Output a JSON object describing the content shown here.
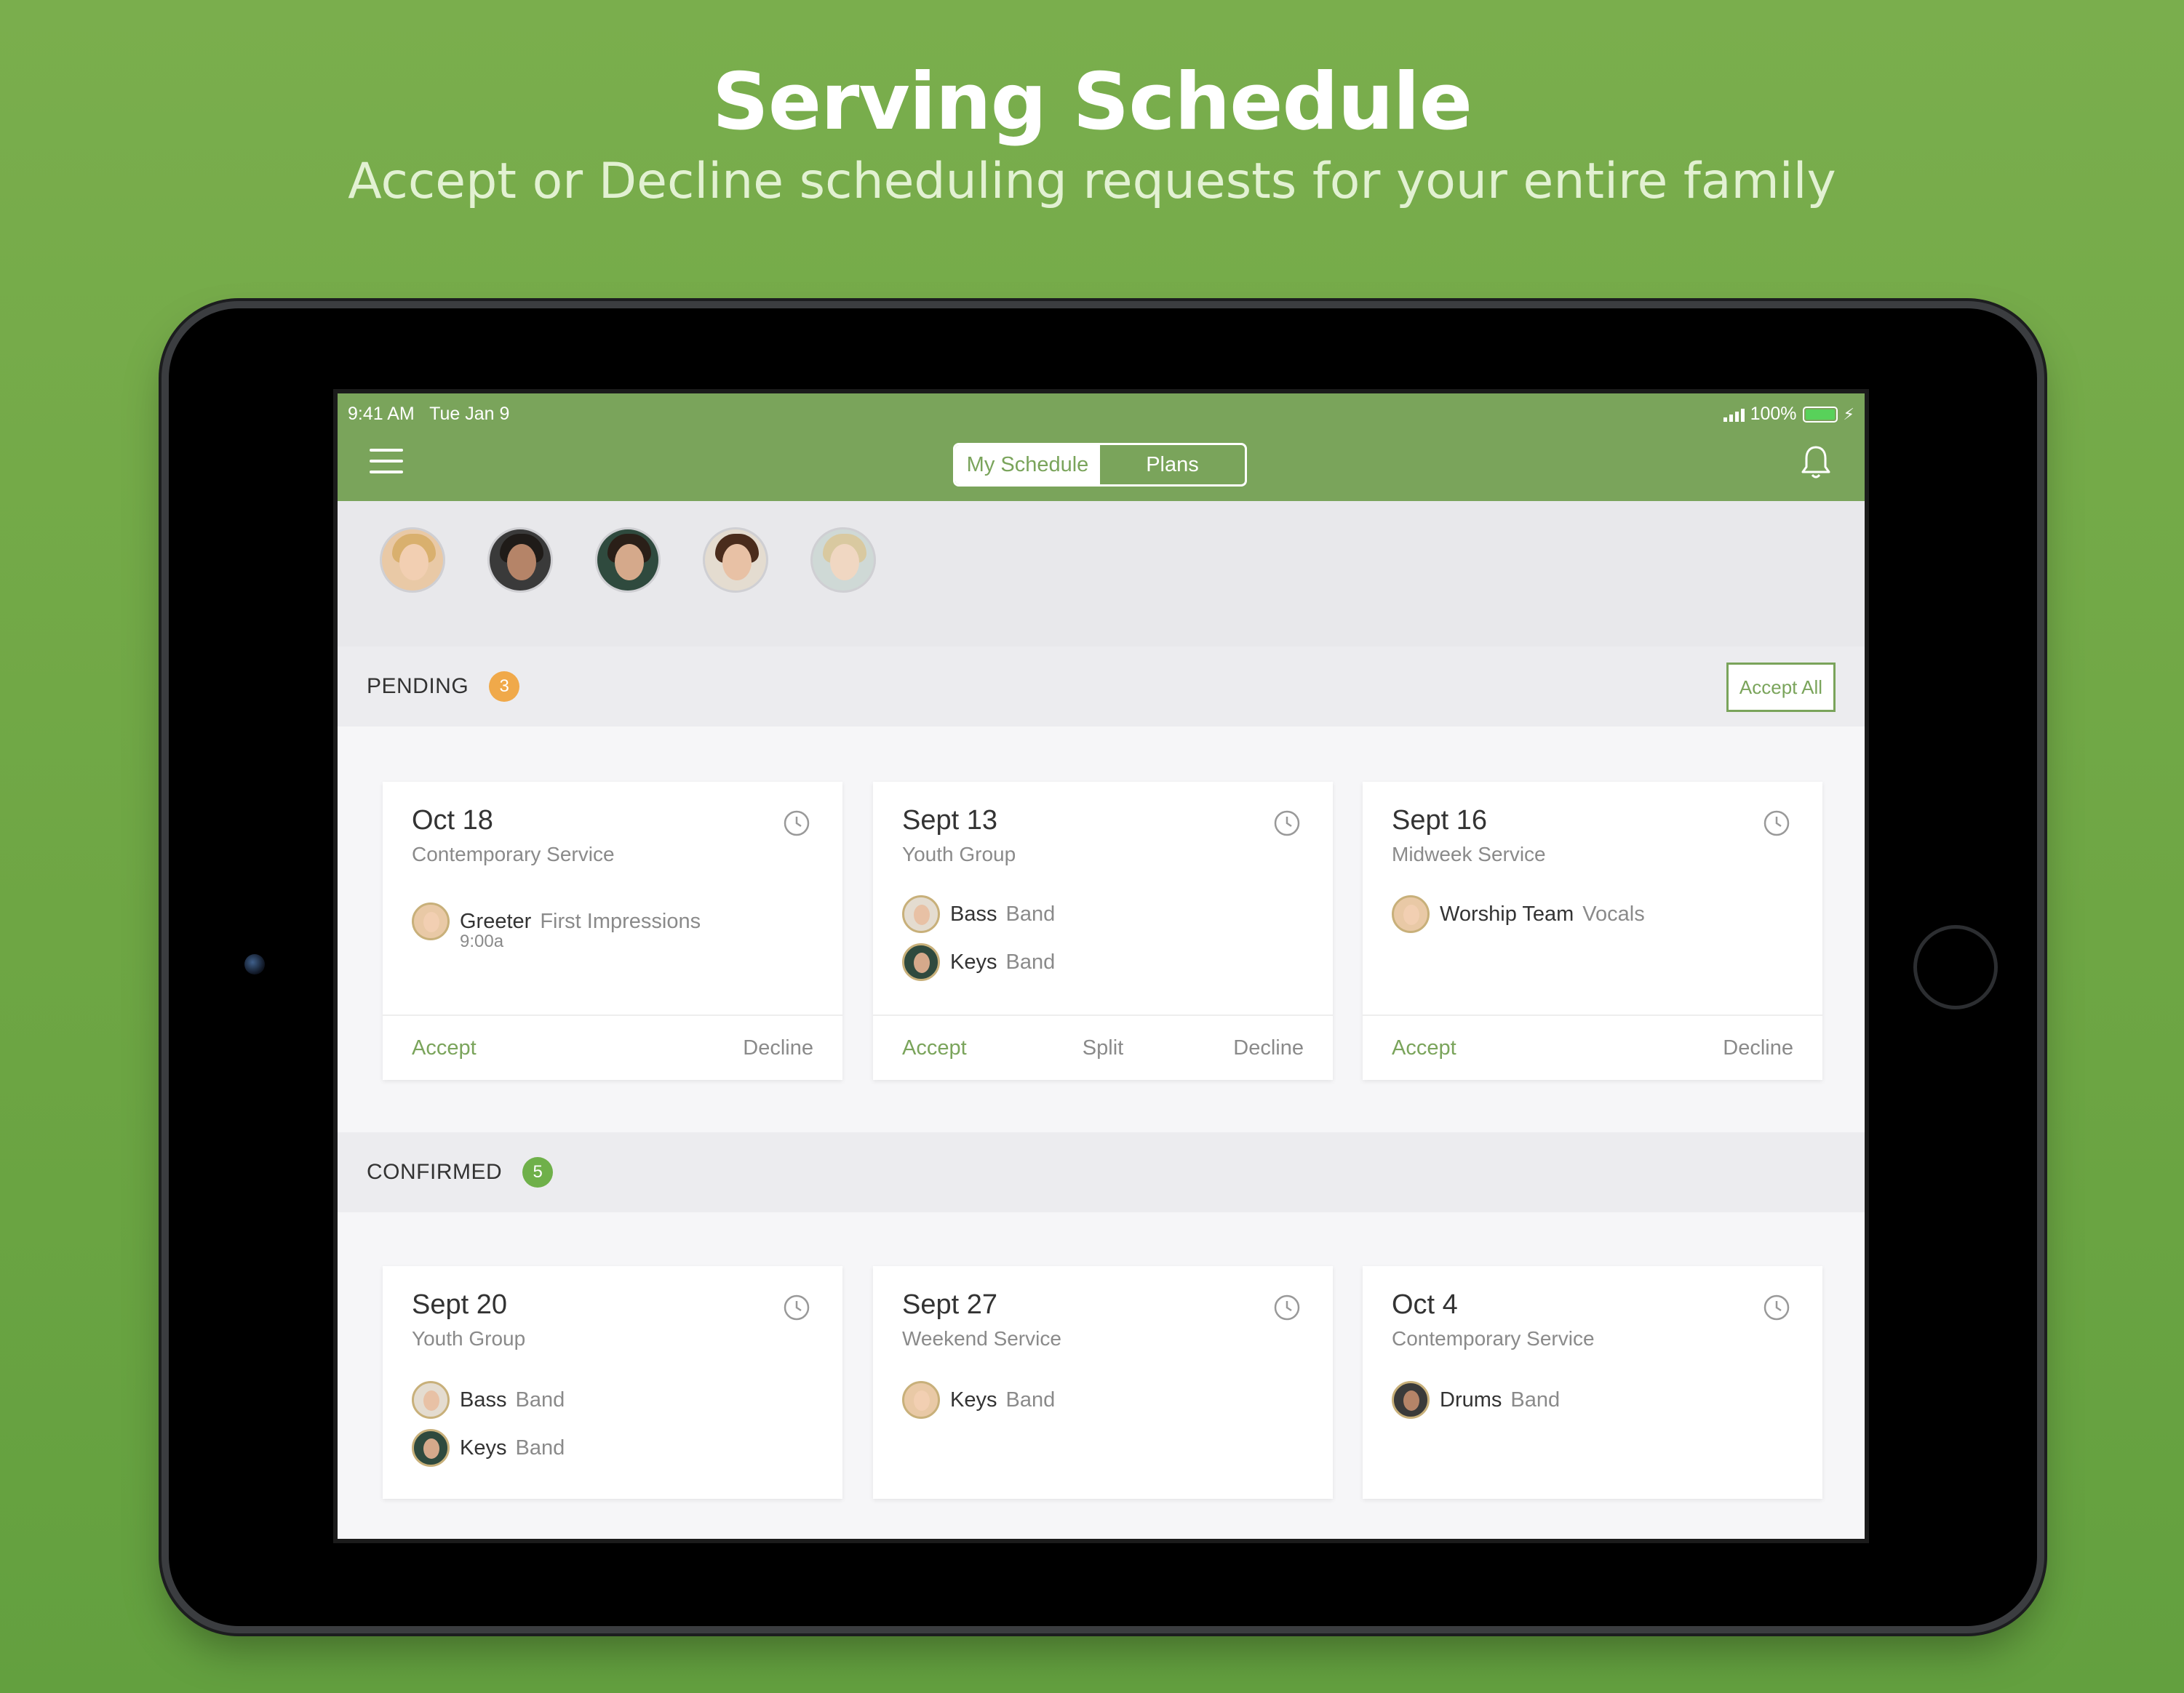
{
  "hero": {
    "title": "Serving Schedule",
    "subtitle": "Accept or Decline scheduling requests for your entire family"
  },
  "status_bar": {
    "time": "9:41 AM   Tue Jan 9",
    "battery": "100%"
  },
  "header": {
    "tabs": [
      {
        "label": "My Schedule",
        "active": true
      },
      {
        "label": "Plans",
        "active": false
      }
    ]
  },
  "family": [
    {
      "name": "member-1"
    },
    {
      "name": "member-2"
    },
    {
      "name": "member-3"
    },
    {
      "name": "member-4"
    },
    {
      "name": "member-5"
    }
  ],
  "pending": {
    "label": "PENDING",
    "count": "3",
    "accept_all": "Accept All",
    "cards": [
      {
        "date": "Oct 18",
        "service": "Contemporary Service",
        "assignments": [
          {
            "role": "Greeter",
            "team": "First Impressions",
            "time": "9:00a"
          }
        ],
        "actions": {
          "accept": "Accept",
          "decline": "Decline"
        }
      },
      {
        "date": "Sept 13",
        "service": "Youth Group",
        "assignments": [
          {
            "role": "Bass",
            "team": "Band"
          },
          {
            "role": "Keys",
            "team": "Band"
          }
        ],
        "actions": {
          "accept": "Accept",
          "split": "Split",
          "decline": "Decline"
        }
      },
      {
        "date": "Sept 16",
        "service": "Midweek Service",
        "assignments": [
          {
            "role": "Worship Team",
            "team": "Vocals"
          }
        ],
        "actions": {
          "accept": "Accept",
          "decline": "Decline"
        }
      }
    ]
  },
  "confirmed": {
    "label": "CONFIRMED",
    "count": "5",
    "cards": [
      {
        "date": "Sept 20",
        "service": "Youth Group",
        "assignments": [
          {
            "role": "Bass",
            "team": "Band"
          },
          {
            "role": "Keys",
            "team": "Band"
          }
        ]
      },
      {
        "date": "Sept 27",
        "service": "Weekend Service",
        "assignments": [
          {
            "role": "Keys",
            "team": "Band"
          }
        ]
      },
      {
        "date": "Oct 4",
        "service": "Contemporary Service",
        "assignments": [
          {
            "role": "Drums",
            "team": "Band"
          }
        ]
      }
    ]
  },
  "colors": {
    "background": "#6ea644",
    "header": "#7aa45b",
    "accent": "#7aa45b",
    "pending_badge": "#f0a94a",
    "confirmed_badge": "#6fb04a"
  },
  "icons": [
    "menu-icon",
    "bell-icon",
    "clock-icon",
    "signal-icon",
    "battery-icon"
  ]
}
